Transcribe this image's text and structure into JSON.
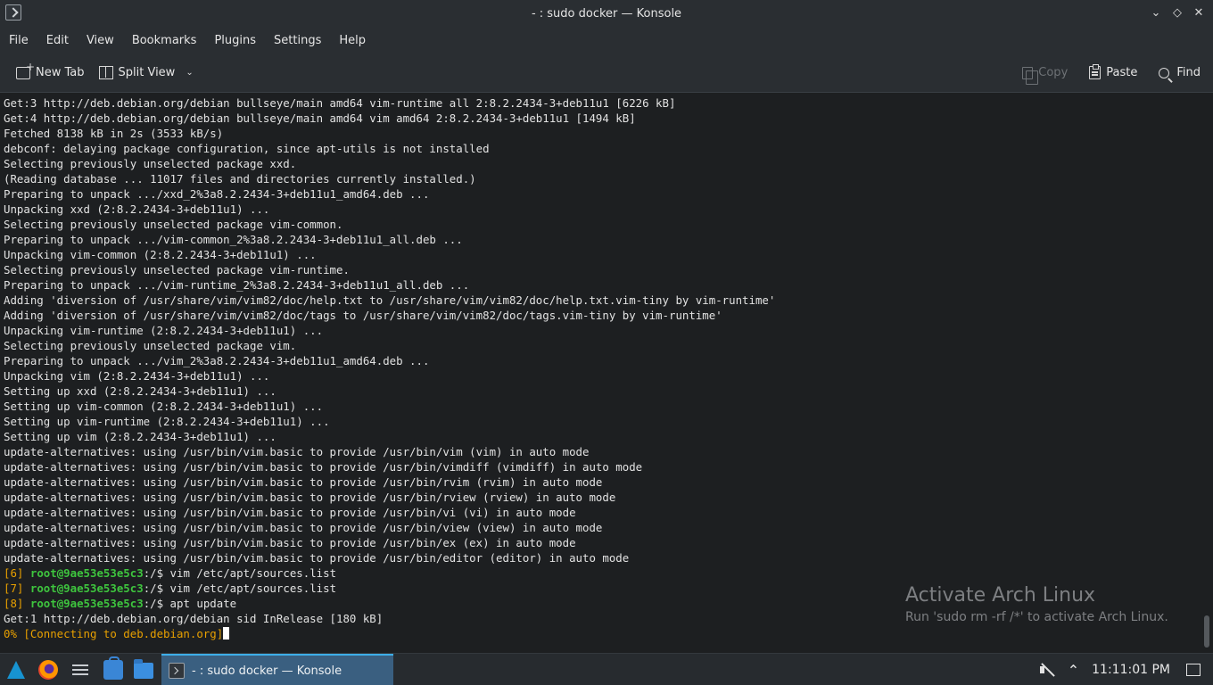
{
  "window": {
    "title": "- : sudo docker — Konsole",
    "controls": [
      "minimize",
      "maximize",
      "close"
    ]
  },
  "menubar": {
    "items": [
      "File",
      "Edit",
      "View",
      "Bookmarks",
      "Plugins",
      "Settings",
      "Help"
    ]
  },
  "toolbar": {
    "new_tab": "New Tab",
    "split_view": "Split View",
    "copy": "Copy",
    "paste": "Paste",
    "find": "Find"
  },
  "terminal": {
    "lines": [
      "Get:3 http://deb.debian.org/debian bullseye/main amd64 vim-runtime all 2:8.2.2434-3+deb11u1 [6226 kB]",
      "Get:4 http://deb.debian.org/debian bullseye/main amd64 vim amd64 2:8.2.2434-3+deb11u1 [1494 kB]",
      "Fetched 8138 kB in 2s (3533 kB/s)",
      "debconf: delaying package configuration, since apt-utils is not installed",
      "Selecting previously unselected package xxd.",
      "(Reading database ... 11017 files and directories currently installed.)",
      "Preparing to unpack .../xxd_2%3a8.2.2434-3+deb11u1_amd64.deb ...",
      "Unpacking xxd (2:8.2.2434-3+deb11u1) ...",
      "Selecting previously unselected package vim-common.",
      "Preparing to unpack .../vim-common_2%3a8.2.2434-3+deb11u1_all.deb ...",
      "Unpacking vim-common (2:8.2.2434-3+deb11u1) ...",
      "Selecting previously unselected package vim-runtime.",
      "Preparing to unpack .../vim-runtime_2%3a8.2.2434-3+deb11u1_all.deb ...",
      "Adding 'diversion of /usr/share/vim/vim82/doc/help.txt to /usr/share/vim/vim82/doc/help.txt.vim-tiny by vim-runtime'",
      "Adding 'diversion of /usr/share/vim/vim82/doc/tags to /usr/share/vim/vim82/doc/tags.vim-tiny by vim-runtime'",
      "Unpacking vim-runtime (2:8.2.2434-3+deb11u1) ...",
      "Selecting previously unselected package vim.",
      "Preparing to unpack .../vim_2%3a8.2.2434-3+deb11u1_amd64.deb ...",
      "Unpacking vim (2:8.2.2434-3+deb11u1) ...",
      "Setting up xxd (2:8.2.2434-3+deb11u1) ...",
      "Setting up vim-common (2:8.2.2434-3+deb11u1) ...",
      "Setting up vim-runtime (2:8.2.2434-3+deb11u1) ...",
      "Setting up vim (2:8.2.2434-3+deb11u1) ...",
      "update-alternatives: using /usr/bin/vim.basic to provide /usr/bin/vim (vim) in auto mode",
      "update-alternatives: using /usr/bin/vim.basic to provide /usr/bin/vimdiff (vimdiff) in auto mode",
      "update-alternatives: using /usr/bin/vim.basic to provide /usr/bin/rvim (rvim) in auto mode",
      "update-alternatives: using /usr/bin/vim.basic to provide /usr/bin/rview (rview) in auto mode",
      "update-alternatives: using /usr/bin/vim.basic to provide /usr/bin/vi (vi) in auto mode",
      "update-alternatives: using /usr/bin/vim.basic to provide /usr/bin/view (view) in auto mode",
      "update-alternatives: using /usr/bin/vim.basic to provide /usr/bin/ex (ex) in auto mode",
      "update-alternatives: using /usr/bin/vim.basic to provide /usr/bin/editor (editor) in auto mode"
    ],
    "prompts": [
      {
        "num": "[6]",
        "user": "root@9ae53e53e5c3",
        "path": ":/$",
        "cmd": " vim /etc/apt/sources.list"
      },
      {
        "num": "[7]",
        "user": "root@9ae53e53e5c3",
        "path": ":/$",
        "cmd": " vim /etc/apt/sources.list"
      },
      {
        "num": "[8]",
        "user": "root@9ae53e53e5c3",
        "path": ":/$",
        "cmd": " apt update"
      }
    ],
    "after_lines": [
      "Get:1 http://deb.debian.org/debian sid InRelease [180 kB]"
    ],
    "progress": "0% [Connecting to deb.debian.org]"
  },
  "watermark": {
    "title": "Activate Arch Linux",
    "subtitle": "Run 'sudo rm -rf /*' to activate Arch Linux."
  },
  "taskbar": {
    "launchers": [
      "arch-icon",
      "firefox-icon",
      "mixer-icon",
      "store-icon",
      "folder-icon"
    ],
    "active_task": "- : sudo docker — Konsole",
    "clock": "11:11:01 PM"
  }
}
